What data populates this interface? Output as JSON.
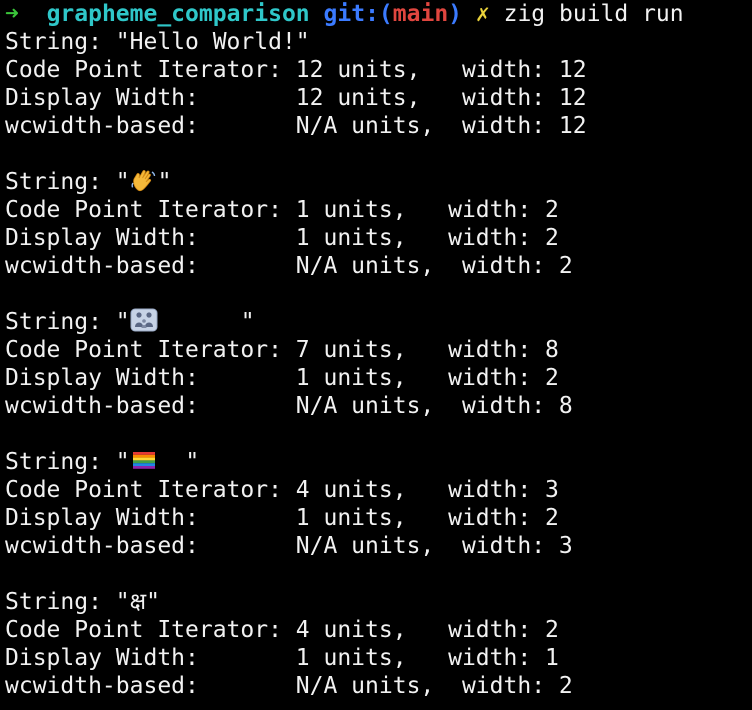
{
  "prompt": {
    "arrow": "➜",
    "directory": "grapheme_comparison",
    "git_prefix": "git:(",
    "branch": "main",
    "git_suffix": ")",
    "dirty_mark": "✗",
    "command": "zig build run"
  },
  "blocks": [
    {
      "string_line": "String: \"Hello World!\"",
      "rows": [
        "Code Point Iterator: 12 units,   width: 12",
        "Display Width:       12 units,   width: 12",
        "wcwidth-based:       N/A units,  width: 12"
      ]
    },
    {
      "string_prefix": "String: \"",
      "emoji": "waving-hand-icon",
      "string_suffix": "\"",
      "rows": [
        "Code Point Iterator: 1 units,   width: 2",
        "Display Width:       1 units,   width: 2",
        "wcwidth-based:       N/A units,  width: 2"
      ]
    },
    {
      "string_prefix": "String: \"",
      "emoji": "family-icon",
      "string_suffix": "      \"",
      "rows": [
        "Code Point Iterator: 7 units,   width: 8",
        "Display Width:       1 units,   width: 2",
        "wcwidth-based:       N/A units,  width: 8"
      ]
    },
    {
      "string_prefix": "String: \"",
      "emoji": "rainbow-flag-icon",
      "string_suffix": "  \"",
      "rows": [
        "Code Point Iterator: 4 units,   width: 3",
        "Display Width:       1 units,   width: 2",
        "wcwidth-based:       N/A units,  width: 3"
      ]
    },
    {
      "string_line": "String: \"क्ष\"",
      "rows": [
        "Code Point Iterator: 4 units,   width: 2",
        "Display Width:       1 units,   width: 1",
        "wcwidth-based:       N/A units,  width: 2"
      ]
    }
  ],
  "colors": {
    "background": "#000000",
    "text": "#f2f2f2",
    "arrow": "#3ac53a",
    "directory": "#2fc7c9",
    "git": "#3b7bff",
    "branch": "#e0463f",
    "dirty": "#e9d23b"
  }
}
